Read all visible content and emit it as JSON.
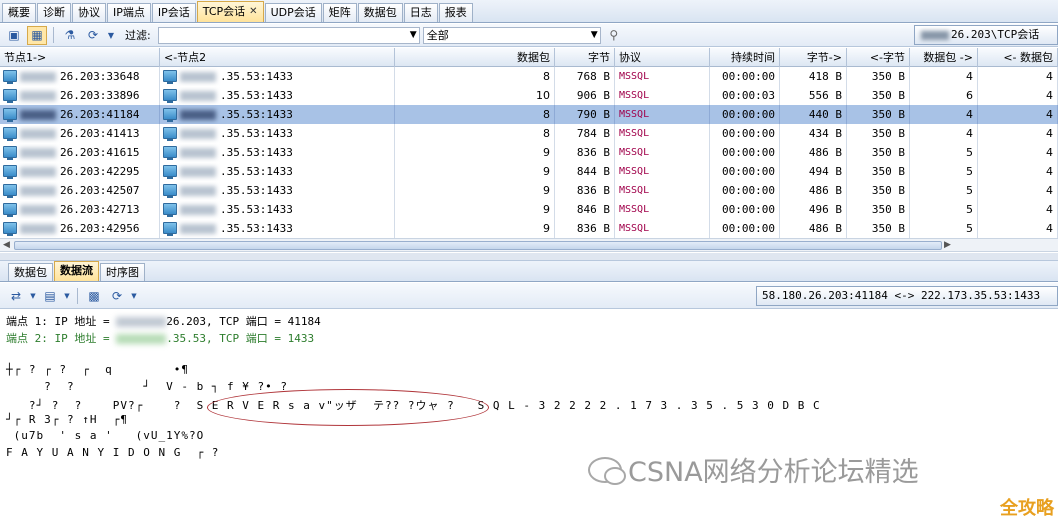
{
  "tabs": [
    {
      "label": "概要"
    },
    {
      "label": "诊断"
    },
    {
      "label": "协议"
    },
    {
      "label": "IP端点"
    },
    {
      "label": "IP会话"
    },
    {
      "label": "TCP会话",
      "active": true
    },
    {
      "label": "UDP会话"
    },
    {
      "label": "矩阵"
    },
    {
      "label": "数据包"
    },
    {
      "label": "日志"
    },
    {
      "label": "报表"
    }
  ],
  "toolbar": {
    "filter_label": "过滤:",
    "filter_value": "",
    "scope_value": "全部",
    "search_icon": "search-icon",
    "session_label": "26.203\\TCP会话"
  },
  "grid": {
    "columns": [
      "节点1->",
      "<-节点2",
      "数据包",
      "字节",
      "协议",
      "持续时间",
      "字节->",
      "<-字节",
      "数据包 ->",
      "<- 数据包"
    ],
    "rows": [
      {
        "n1": "26.203:33648",
        "n2": ".35.53:1433",
        "packets": "8",
        "bytes": "768  B",
        "proto": "MSSQL",
        "dur": "00:00:00",
        "b_out": "418  B",
        "b_in": "350  B",
        "p_out": "4",
        "p_in": "4"
      },
      {
        "n1": "26.203:33896",
        "n2": ".35.53:1433",
        "packets": "10",
        "bytes": "906  B",
        "proto": "MSSQL",
        "dur": "00:00:03",
        "b_out": "556  B",
        "b_in": "350  B",
        "p_out": "6",
        "p_in": "4"
      },
      {
        "n1": "26.203:41184",
        "n2": ".35.53:1433",
        "packets": "8",
        "bytes": "790  B",
        "proto": "MSSQL",
        "dur": "00:00:00",
        "b_out": "440  B",
        "b_in": "350  B",
        "p_out": "4",
        "p_in": "4",
        "selected": true
      },
      {
        "n1": "26.203:41413",
        "n2": ".35.53:1433",
        "packets": "8",
        "bytes": "784  B",
        "proto": "MSSQL",
        "dur": "00:00:00",
        "b_out": "434  B",
        "b_in": "350  B",
        "p_out": "4",
        "p_in": "4"
      },
      {
        "n1": "26.203:41615",
        "n2": ".35.53:1433",
        "packets": "9",
        "bytes": "836  B",
        "proto": "MSSQL",
        "dur": "00:00:00",
        "b_out": "486  B",
        "b_in": "350  B",
        "p_out": "5",
        "p_in": "4"
      },
      {
        "n1": "26.203:42295",
        "n2": ".35.53:1433",
        "packets": "9",
        "bytes": "844  B",
        "proto": "MSSQL",
        "dur": "00:00:00",
        "b_out": "494  B",
        "b_in": "350  B",
        "p_out": "5",
        "p_in": "4"
      },
      {
        "n1": "26.203:42507",
        "n2": ".35.53:1433",
        "packets": "9",
        "bytes": "836  B",
        "proto": "MSSQL",
        "dur": "00:00:00",
        "b_out": "486  B",
        "b_in": "350  B",
        "p_out": "5",
        "p_in": "4"
      },
      {
        "n1": "26.203:42713",
        "n2": ".35.53:1433",
        "packets": "9",
        "bytes": "846  B",
        "proto": "MSSQL",
        "dur": "00:00:00",
        "b_out": "496  B",
        "b_in": "350  B",
        "p_out": "5",
        "p_in": "4"
      },
      {
        "n1": "26.203:42956",
        "n2": ".35.53:1433",
        "packets": "9",
        "bytes": "836  B",
        "proto": "MSSQL",
        "dur": "00:00:00",
        "b_out": "486  B",
        "b_in": "350  B",
        "p_out": "5",
        "p_in": "4"
      }
    ]
  },
  "subtabs": [
    {
      "label": "数据包"
    },
    {
      "label": "数据流",
      "active": true
    },
    {
      "label": "时序图"
    }
  ],
  "stream": {
    "endpoint_summary": "58.180.26.203:41184 <-> 222.173.35.53:1433",
    "ep1_prefix": "端点 1: IP 地址 = ",
    "ep1_suffix": "26.203, TCP 端口 = 41184",
    "ep2_prefix": "端点 2: IP 地址 = ",
    "ep2_suffix": ".35.53, TCP 端口 = 1433",
    "lines": [
      "┼┌ ? ┌ ?  ┌  q        •¶",
      "     ?  ?         ┘  V - b ┐ f ¥ ?• ?",
      "   ?┘ ?  ?    PV?┌    ?  S E R V E R s a v\"ッザ  テ?? ?ウャ ?   S Q L - 3 2 2 2 2 . 1 7 3 . 3 5 . 5 3 0 D B C",
      "┘┌ R 3┌ ? ↑H  ┌¶",
      " (u7b  ' s a '   (vU_1Y%?O",
      "F A Y U A N Y I D O N G  ┌ ?"
    ]
  },
  "watermark": "CSNA网络分析论坛精选",
  "badge": "全攻略"
}
